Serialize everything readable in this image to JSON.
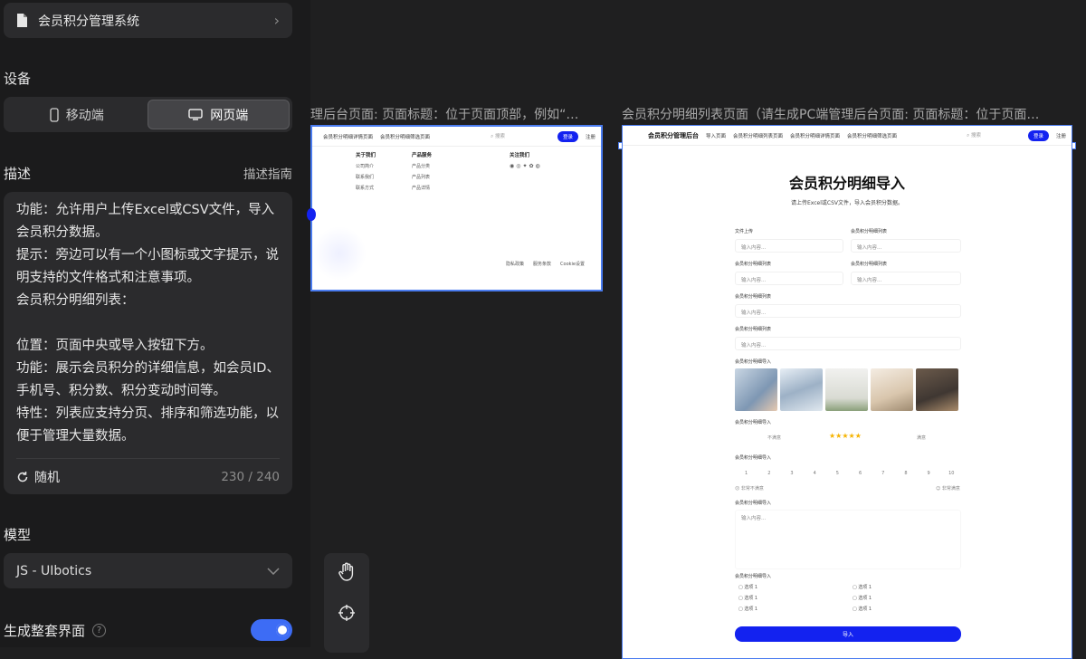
{
  "project": {
    "name": "会员积分管理系统"
  },
  "device": {
    "title": "设备",
    "mobile_label": "移动端",
    "web_label": "网页端",
    "selected": "网页端"
  },
  "description": {
    "title": "描述",
    "guide_link": "描述指南",
    "text": "功能：允许用户上传Excel或CSV文件，导入会员积分数据。\n提示：旁边可以有一个小图标或文字提示，说明支持的文件格式和注意事项。\n会员积分明细列表：\n\n位置：页面中央或导入按钮下方。\n功能：展示会员积分的详细信息，如会员ID、手机号、积分数、积分变动时间等。\n特性：列表应支持分页、排序和筛选功能，以便于管理大量数据。",
    "random_label": "随机",
    "counter": "230 / 240"
  },
  "model": {
    "title": "模型",
    "selected": "JS - UIbotics"
  },
  "generate_full": {
    "label": "生成整套界面",
    "help": "?",
    "enabled": true
  },
  "canvas": {
    "frameA": {
      "title": "理后台页面: 页面标题：位于页面顶部，例如“…",
      "nav": [
        "会员积分明细详情页面",
        "会员积分明细筛选页面"
      ],
      "search": "搜索",
      "login": "登录",
      "register": "注册",
      "footer": {
        "about_title": "关于我们",
        "about_items": [
          "公司简介",
          "联系我们",
          "联系方式"
        ],
        "product_title": "产品服务",
        "product_items": [
          "产品分类",
          "产品列表",
          "产品详情"
        ],
        "follow_title": "关注我们",
        "bottom_links": [
          "隐私政策",
          "服务条款",
          "Cookie设置"
        ]
      }
    },
    "frameB": {
      "title": "会员积分明细列表页面（请生成PC端管理后台页面: 页面标题：位于页面…",
      "brand": "会员积分管理后台",
      "nav": [
        "导入页面",
        "会员积分明细列表页面",
        "会员积分明细详情页面",
        "会员积分明细筛选页面"
      ],
      "search": "搜索",
      "login": "登录",
      "register": "注册",
      "heading": "会员积分明细导入",
      "subheading": "请上传Excel或CSV文件，导入会员积分数据。",
      "file_label": "文件上传",
      "list_label": "会员积分明细列表",
      "placeholder": "输入内容...",
      "image_label": "会员积分明细导入",
      "rating_label": "会员积分明细导入",
      "rating_low": "不满意",
      "rating_high": "满意",
      "rating_value": 5,
      "scale_label": "会员积分明细导入",
      "scale": [
        "1",
        "2",
        "3",
        "4",
        "5",
        "6",
        "7",
        "8",
        "9",
        "10"
      ],
      "scale_low": "非常不满意",
      "scale_high": "非常满意",
      "text_label": "会员积分明细导入",
      "textarea_placeholder": "输入内容...",
      "options_label": "会员积分明细导入",
      "options": [
        "选项 1",
        "选项 1",
        "选项 1",
        "选项 1",
        "选项 1",
        "选项 1"
      ],
      "submit": "导入"
    }
  },
  "colors": {
    "accent": "#3d6cf5",
    "primary_button": "#1322f0",
    "selection": "#4a7cf0"
  }
}
